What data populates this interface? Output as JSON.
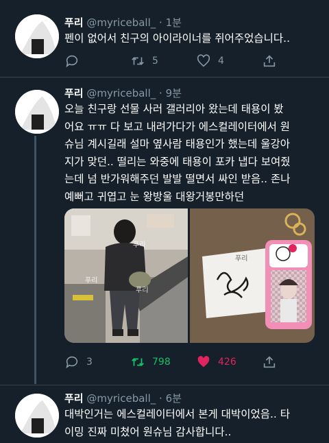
{
  "tweets": [
    {
      "name": "푸리",
      "handle": "@myriceball_",
      "time": "· 1분",
      "text": "펜이 없어서 친구의 아이라이너를 쥐어주었습니다..",
      "actions": {
        "reply": "",
        "retweet": "5",
        "like": "4"
      }
    },
    {
      "name": "푸리",
      "handle": "@myriceball_",
      "time": "· 9분",
      "text": "오늘 친구랑 선물 사러 갤러리아 왔는데 태용이 봤\n어요 ㅠㅠ 다 보고 내려가다가 에스컬레이터에서 원\n슈님 계시길래 설마 옆사람 태용인가 했는데 울강아\n지가 맞던.. 떨리는 와중에 태용이 포카 냅다 보여줬\n는데 넘 반가워해주던 발발 떨면서 싸인 받음.. 존나\n예뻐고 귀엽고 눈 왕방울 대왕거봉만하던",
      "media_watermark": "푸리",
      "actions": {
        "reply": "3",
        "retweet": "798",
        "like": "426"
      }
    },
    {
      "name": "푸리",
      "handle": "@myriceball_",
      "time": "· 6분",
      "text": "대박인거는 에스컬레이터에서 본게 대박이었음.. 타\n이밍 진짜 미쳤어 원슈님 감사합니다.."
    }
  ],
  "colors": {
    "background": "#15202b",
    "secondary_text": "#8899a6",
    "retweet_active": "#17bf63",
    "like_active": "#e0245e",
    "divider": "#38444d"
  },
  "icons": [
    "onigiri-avatar",
    "reply-icon",
    "retweet-icon",
    "like-icon",
    "share-icon"
  ]
}
